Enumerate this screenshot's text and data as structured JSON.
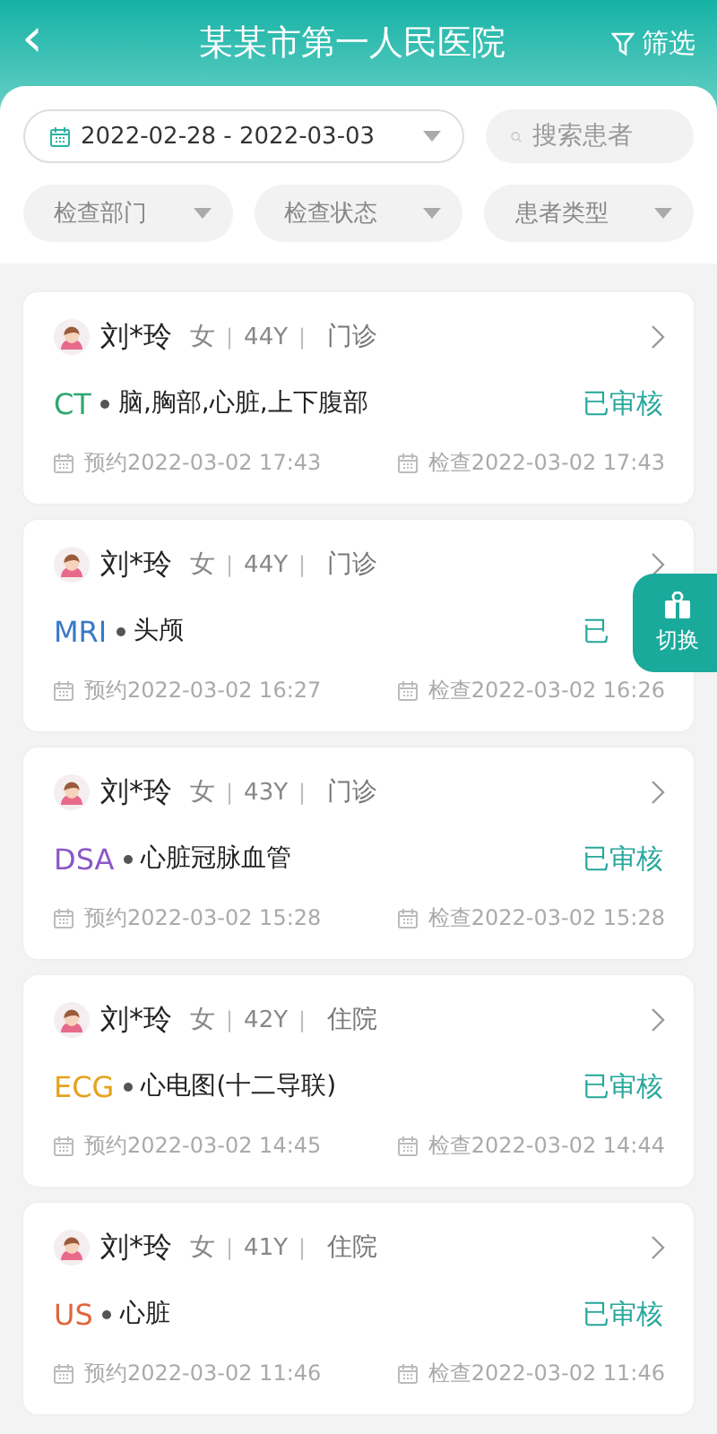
{
  "header": {
    "back_icon": "‹",
    "title": "某某市第一人民医院",
    "filter_label": "筛选"
  },
  "filters": {
    "date_range": "2022-02-28 - 2022-03-03",
    "search": {
      "placeholder": "搜索患者"
    },
    "dropdowns": [
      "检查部门",
      "检查状态",
      "患者类型"
    ]
  },
  "records": [
    {
      "name": "刘*玲",
      "gender": "女",
      "age": "44Y",
      "visit_type": "门诊",
      "modality": "CT",
      "color": "#2ea870",
      "exam": "脑,胸部,心脏,上下腹部",
      "status": "已审核",
      "booked": "预约2022-03-02 17:43",
      "checked": "检查2022-03-02 17:43"
    },
    {
      "name": "刘*玲",
      "gender": "女",
      "age": "44Y",
      "visit_type": "门诊",
      "modality": "MRI",
      "color": "#3a78c8",
      "exam": "头颅",
      "status": "已",
      "booked": "预约2022-03-02 16:27",
      "checked": "检查2022-03-02 16:26"
    },
    {
      "name": "刘*玲",
      "gender": "女",
      "age": "43Y",
      "visit_type": "门诊",
      "modality": "DSA",
      "color": "#8a58c8",
      "exam": "心脏冠脉血管",
      "status": "已审核",
      "booked": "预约2022-03-02 15:28",
      "checked": "检查2022-03-02 15:28"
    },
    {
      "name": "刘*玲",
      "gender": "女",
      "age": "42Y",
      "visit_type": "住院",
      "modality": "ECG",
      "color": "#e6a21c",
      "exam": "心电图(十二导联)",
      "status": "已审核",
      "booked": "预约2022-03-02 14:45",
      "checked": "检查2022-03-02 14:44"
    },
    {
      "name": "刘*玲",
      "gender": "女",
      "age": "41Y",
      "visit_type": "住院",
      "modality": "US",
      "color": "#e0653c",
      "exam": "心脏",
      "status": "已审核",
      "booked": "预约2022-03-02 11:46",
      "checked": "检查2022-03-02 11:46"
    }
  ],
  "float_button": {
    "label": "切换"
  },
  "separator": "|"
}
